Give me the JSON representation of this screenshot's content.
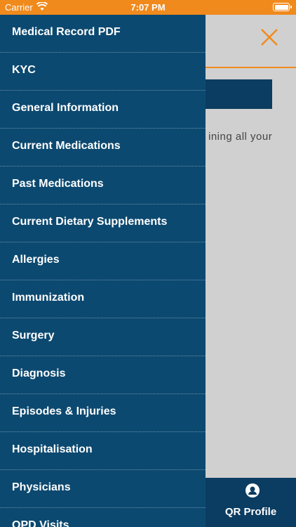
{
  "status_bar": {
    "carrier": "Carrier",
    "time": "7:07 PM"
  },
  "background": {
    "text_fragment": "ining all your",
    "bottom_tab_label": "QR Profile"
  },
  "drawer": {
    "items": [
      {
        "label": "Medical Record PDF"
      },
      {
        "label": "KYC"
      },
      {
        "label": "General Information"
      },
      {
        "label": "Current Medications"
      },
      {
        "label": "Past Medications"
      },
      {
        "label": "Current Dietary Supplements"
      },
      {
        "label": "Allergies"
      },
      {
        "label": "Immunization"
      },
      {
        "label": "Surgery"
      },
      {
        "label": "Diagnosis"
      },
      {
        "label": "Episodes & Injuries"
      },
      {
        "label": "Hospitalisation"
      },
      {
        "label": "Physicians"
      },
      {
        "label": "OPD Visits"
      }
    ]
  },
  "colors": {
    "accent": "#f08a1c",
    "drawer": "#0c4970",
    "dark_navy": "#0b3c61"
  }
}
